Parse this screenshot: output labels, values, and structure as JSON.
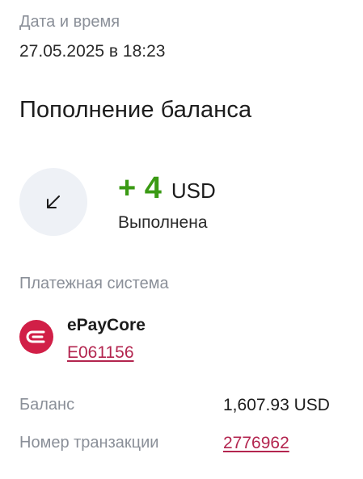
{
  "datetime": {
    "label": "Дата и время",
    "value": "27.05.2025 в 18:23"
  },
  "title": "Пополнение баланса",
  "transaction": {
    "icon": "arrow-down-left-icon",
    "amount": "+ 4",
    "currency": "USD",
    "status": "Выполнена",
    "amount_color": "#3a9a14"
  },
  "payment_system": {
    "label": "Платежная система",
    "logo_icon": "epaycore-logo-icon",
    "logo_color": "#d11f47",
    "name": "ePayCore",
    "account": "E061156"
  },
  "balance": {
    "label": "Баланс",
    "value": "1,607.93 USD"
  },
  "transaction_number": {
    "label": "Номер транзакции",
    "value": "2776962"
  },
  "link_color": "#b3254f"
}
